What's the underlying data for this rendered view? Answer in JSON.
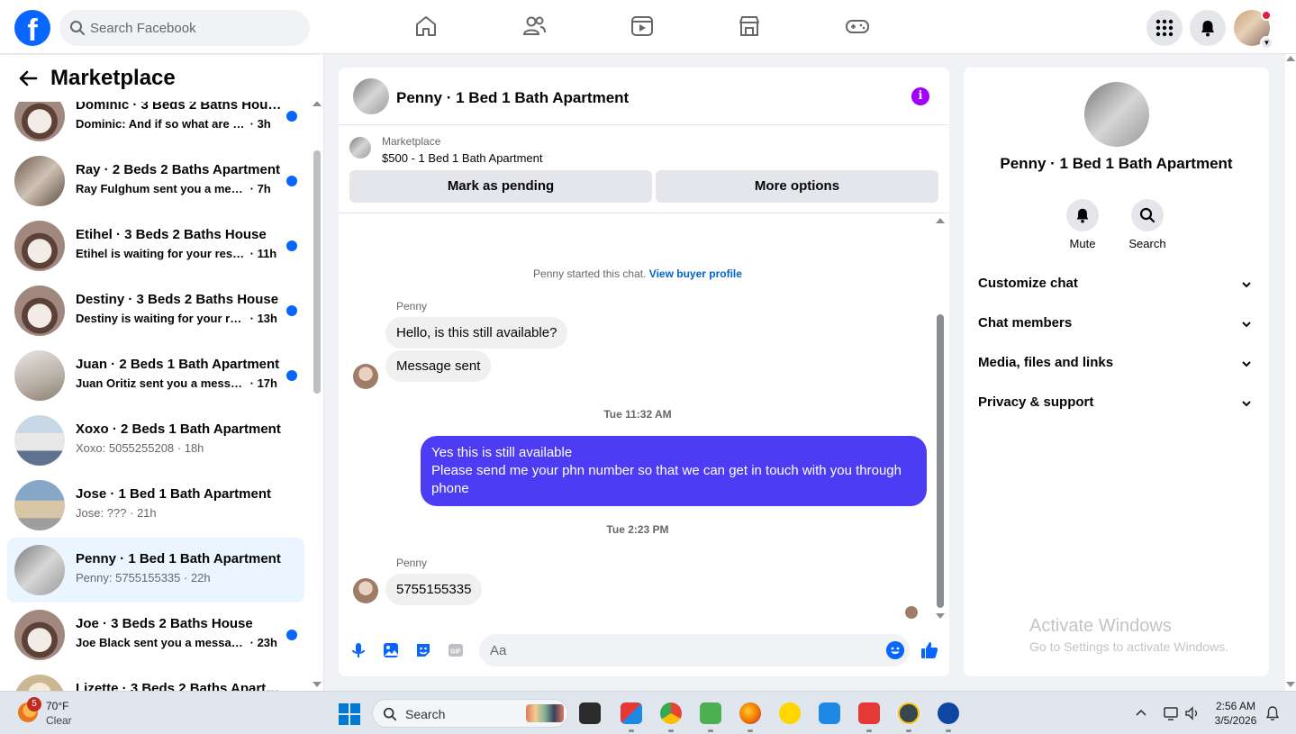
{
  "topbar": {
    "logo": "f",
    "search_placeholder": "Search Facebook",
    "nav_icons": [
      "home-icon",
      "friends-icon",
      "video-icon",
      "marketplace-icon",
      "gaming-icon"
    ],
    "right_icons": [
      "menu-grid-icon",
      "notifications-bell-icon",
      "account-avatar"
    ]
  },
  "sidebar": {
    "title": "Marketplace",
    "conversations": [
      {
        "name": "Dominic · 3 Beds 2 Baths House",
        "preview": "Dominic: And if so what are the ...",
        "time": "3h",
        "unread": true
      },
      {
        "name": "Ray · 2 Beds 2 Baths Apartment",
        "preview": "Ray Fulghum sent you a messag...",
        "time": "7h",
        "unread": true
      },
      {
        "name": "Etihel · 3 Beds 2 Baths House",
        "preview": "Etihel is waiting for your respo...",
        "time": "11h",
        "unread": true
      },
      {
        "name": "Destiny · 3 Beds 2 Baths House",
        "preview": "Destiny is waiting for your res...",
        "time": "13h",
        "unread": true
      },
      {
        "name": "Juan · 2 Beds 1 Bath Apartment",
        "preview": "Juan Oritiz sent you a message...",
        "time": "17h",
        "unread": true
      },
      {
        "name": "Xoxo · 2 Beds 1 Bath Apartment",
        "preview": "Xoxo: 5055255208",
        "time": "18h",
        "unread": false
      },
      {
        "name": "Jose · 1 Bed 1 Bath Apartment",
        "preview": "Jose: ???",
        "time": "21h",
        "unread": false
      },
      {
        "name": "Penny · 1 Bed 1 Bath Apartment",
        "preview": "Penny: 5755155335",
        "time": "22h",
        "unread": false
      },
      {
        "name": "Joe · 3 Beds 2 Baths House",
        "preview": "Joe Black sent you a message a...",
        "time": "23h",
        "unread": true
      },
      {
        "name": "Lizette · 3 Beds 2 Baths Apartme...",
        "preview": "",
        "time": "",
        "unread": false
      }
    ]
  },
  "chat": {
    "title": "Penny · 1 Bed 1 Bath Apartment",
    "listing": {
      "source": "Marketplace",
      "summary": "$500 - 1 Bed 1 Bath Apartment"
    },
    "buttons": {
      "pending": "Mark as pending",
      "more": "More options"
    },
    "system_text": "Penny started this chat.",
    "system_link": "View buyer profile",
    "sender_name": "Penny",
    "in_msg_1": "Hello, is this still available?",
    "in_msg_2": "Message sent",
    "ts_1": "Tue 11:32 AM",
    "out_line_1": "Yes this is still available",
    "out_line_2": "Please send me your phn number so that we can get in touch with you through phone",
    "ts_2": "Tue 2:23 PM",
    "in_msg_3": "5755155335",
    "composer_placeholder": "Aa"
  },
  "right_panel": {
    "name": "Penny · 1 Bed 1 Bath Apartment",
    "actions": {
      "mute": "Mute",
      "search": "Search"
    },
    "sections": [
      "Customize chat",
      "Chat members",
      "Media, files and links",
      "Privacy & support"
    ]
  },
  "watermark": {
    "line1": "Activate Windows",
    "line2": "Go to Settings to activate Windows."
  },
  "taskbar": {
    "weather_badge": "5",
    "temp": "70°F",
    "condition": "Clear",
    "search_label": "Search",
    "time": "2:56 AM",
    "date": "3/5/2026"
  },
  "colors": {
    "brand": "#0866ff",
    "outgoing_bubble": "#4c3df5",
    "active_row": "#ebf5ff",
    "info_icon": "#a100ff"
  }
}
